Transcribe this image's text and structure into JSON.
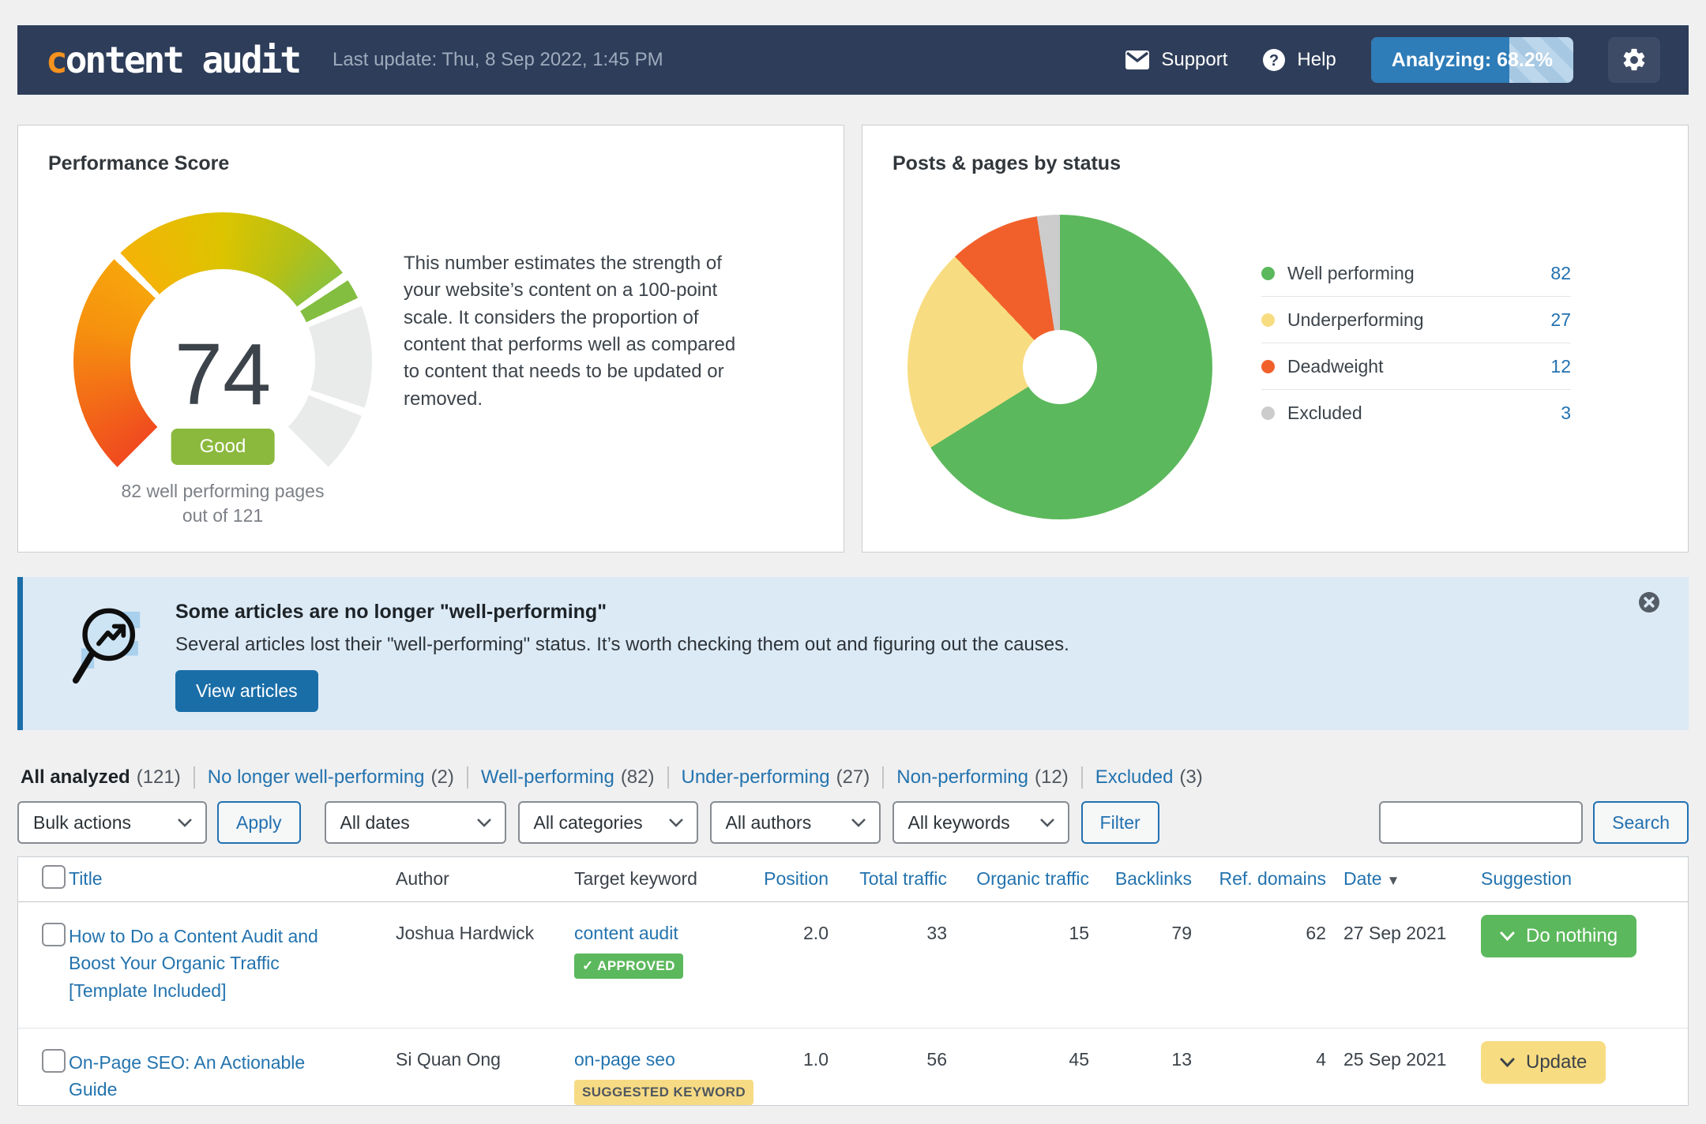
{
  "navbar": {
    "logo_first": "c",
    "logo_rest": "ontent audit",
    "last_update": "Last update: Thu, 8 Sep 2022, 1:45 PM",
    "support_label": "Support",
    "help_label": "Help",
    "analyzing_label": "Analyzing: 68.2%",
    "analyzing_percent": 68.2
  },
  "performance_card": {
    "title": "Performance Score",
    "score": "74",
    "rating": "Good",
    "caption_line1": "82 well performing pages",
    "caption_line2": "out of 121",
    "description": "This number estimates the strength of your website’s content on a 100-point scale. It considers the proportion of content that performs well as compared to content that needs to be updated or removed."
  },
  "status_card": {
    "title": "Posts & pages by status"
  },
  "banner": {
    "title": "Some articles are no longer \"well-performing\"",
    "body": "Several articles lost their \"well-performing\" status. It’s worth checking them out and figuring out the causes.",
    "button_label": "View articles"
  },
  "filter_tabs": [
    {
      "label": "All analyzed",
      "count": "(121)",
      "active": true
    },
    {
      "label": "No longer well-performing",
      "count": "(2)",
      "active": false
    },
    {
      "label": "Well-performing",
      "count": "(82)",
      "active": false
    },
    {
      "label": "Under-performing",
      "count": "(27)",
      "active": false
    },
    {
      "label": "Non-performing",
      "count": "(12)",
      "active": false
    },
    {
      "label": "Excluded",
      "count": "(3)",
      "active": false
    }
  ],
  "toolbar": {
    "bulk_actions": "Bulk actions",
    "apply": "Apply",
    "dates": "All dates",
    "categories": "All categories",
    "authors": "All authors",
    "keywords": "All keywords",
    "filter": "Filter",
    "search_value": "",
    "search_button": "Search"
  },
  "table": {
    "headers": {
      "title": "Title",
      "author": "Author",
      "keyword": "Target keyword",
      "position": "Position",
      "total_traffic": "Total traffic",
      "organic_traffic": "Organic traffic",
      "backlinks": "Backlinks",
      "ref_domains": "Ref. domains",
      "date": "Date",
      "date_sort": "▼",
      "suggestion": "Suggestion"
    },
    "rows": [
      {
        "title": "How to Do a Content Audit and Boost Your Organic Traffic [Template Included]",
        "author": "Joshua Hardwick",
        "keyword": "content audit",
        "keyword_badge": "✓ APPROVED",
        "position": "2.0",
        "total_traffic": "33",
        "organic_traffic": "15",
        "backlinks": "79",
        "ref_domains": "62",
        "date": "27 Sep 2021",
        "suggestion": "Do nothing"
      },
      {
        "title": "On-Page SEO: An Actionable Guide",
        "author": "Si Quan Ong",
        "keyword": "on-page seo",
        "keyword_badge": "SUGGESTED KEYWORD",
        "position": "1.0",
        "total_traffic": "56",
        "organic_traffic": "45",
        "backlinks": "13",
        "ref_domains": "4",
        "date": "25 Sep 2021",
        "suggestion": "Update"
      }
    ]
  },
  "chart_data": [
    {
      "type": "gauge",
      "title": "Performance Score",
      "value": 74,
      "min": 0,
      "max": 100,
      "arc_degrees": 270,
      "rating": "Good",
      "caption": "82 well performing pages out of 121",
      "gradient_colors": [
        "#f04a1f",
        "#f6920e",
        "#dcc400",
        "#8ec23b"
      ],
      "marker_color": "#83be40",
      "track_color": "#e9eaea"
    },
    {
      "type": "pie",
      "donut": true,
      "title": "Posts & pages by status",
      "categories": [
        "Well performing",
        "Underperforming",
        "Deadweight",
        "Excluded"
      ],
      "values": [
        82,
        27,
        12,
        3
      ],
      "colors": [
        "#5cb85c",
        "#f8dc81",
        "#f1602b",
        "#cccccc"
      ],
      "start_angle": "top",
      "direction": "clockwise",
      "legend_position": "right"
    }
  ],
  "colors": {
    "navbar_bg": "#2e3d59",
    "logo_accent": "#f6921e",
    "link_blue": "#2373ae",
    "button_blue": "#1a6ea8",
    "progress_blue": "#2e7cb8",
    "banner_bg": "#dceaf6",
    "good_badge": "#8bb93d",
    "green": "#5cb85c",
    "yellow": "#f8dc81",
    "orange": "#f1602b",
    "gray": "#cccccc",
    "page_bg": "#f0f0f1"
  }
}
